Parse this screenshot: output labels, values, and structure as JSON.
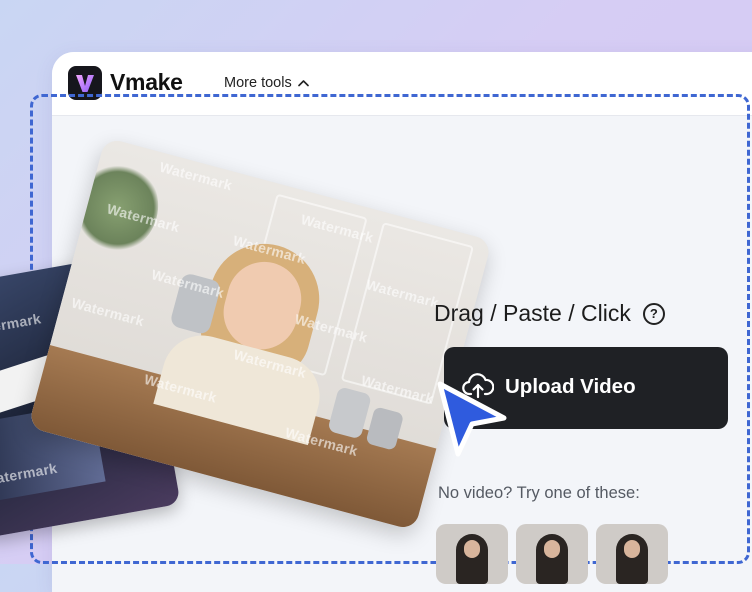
{
  "brand": {
    "name": "Vmake"
  },
  "nav": {
    "more_tools_label": "More tools"
  },
  "upload": {
    "prompt": "Drag / Paste / Click",
    "help_symbol": "?",
    "button_label": "Upload Video",
    "no_video_text": "No video? Try one of these:"
  },
  "preview": {
    "watermark_text": "Watermark"
  },
  "colors": {
    "accent": "#3f67d2",
    "button_bg": "#1f2125",
    "cursor": "#2f5bde"
  },
  "icons": {
    "logo": "vmake-logo-icon",
    "chevron": "chevron-up-icon",
    "help": "help-circle-icon",
    "upload": "cloud-upload-icon",
    "cursor": "mouse-cursor-icon"
  }
}
